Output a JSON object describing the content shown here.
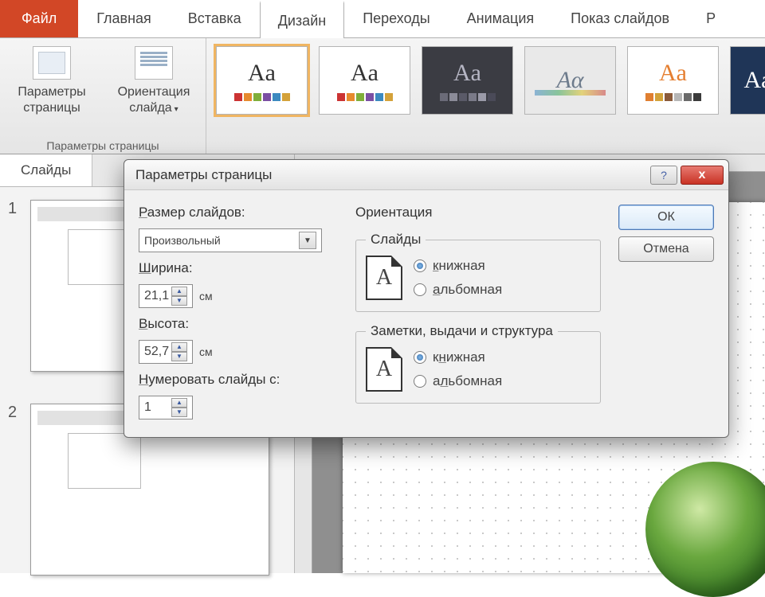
{
  "tabs": {
    "file": "Файл",
    "home": "Главная",
    "insert": "Вставка",
    "design": "Дизайн",
    "transitions": "Переходы",
    "animation": "Анимация",
    "slideshow": "Показ слайдов",
    "cutoff": "Р"
  },
  "ribbon": {
    "page_setup_btn": "Параметры\nстраницы",
    "orientation_btn": "Ориентация\nслайда",
    "group_label": "Параметры страницы"
  },
  "panel": {
    "tab_slides": "Слайды",
    "s1": "1",
    "s2": "2"
  },
  "dialog": {
    "title": "Параметры страницы",
    "size_label": "Размер слайдов:",
    "size_value": "Произвольный",
    "width_label": "Ширина:",
    "width_value": "21,1",
    "height_label": "Высота:",
    "height_value": "52,7",
    "cm": "см",
    "number_from_label": "Нумеровать слайды с:",
    "number_from_value": "1",
    "orientation_header": "Ориентация",
    "group_slides": "Слайды",
    "group_notes": "Заметки, выдачи и структура",
    "opt_portrait": "книжная",
    "opt_landscape": "альбомная",
    "page_glyph": "A",
    "ok": "ОК",
    "cancel": "Отмена",
    "help": "?",
    "close": "x"
  }
}
